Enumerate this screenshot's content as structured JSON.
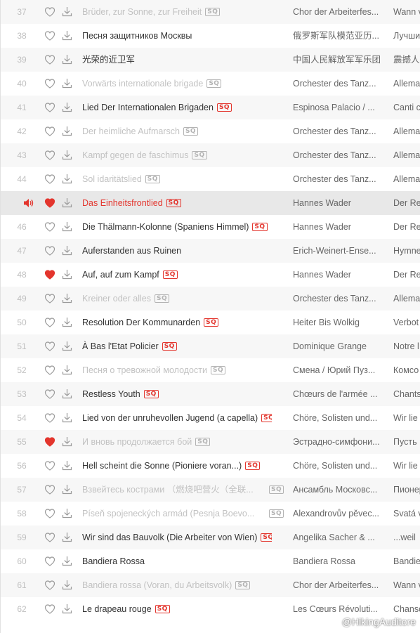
{
  "colors": {
    "accent": "#e3352d",
    "dim_text": "#c2c2c2",
    "liked_heart": "#e3352d"
  },
  "tracks": [
    {
      "no": "37",
      "title": "Brüder, zur Sonne, zur Freiheit",
      "artist": "Chor der Arbeiterfes...",
      "album": "Wann v",
      "sq": true,
      "dim": true,
      "liked": false,
      "playing": false
    },
    {
      "no": "38",
      "title": "Песня защитников Москвы",
      "artist": "俄罗斯军队模范亚历...",
      "album": "Лучши",
      "sq": false,
      "dim": false,
      "liked": false,
      "playing": false
    },
    {
      "no": "39",
      "title": "光荣的近卫军",
      "artist": "中国人民解放军军乐团",
      "album": "震撼人",
      "sq": false,
      "dim": false,
      "liked": false,
      "playing": false
    },
    {
      "no": "40",
      "title": "Vorwärts internationale brigade",
      "artist": "Orchester des Tanz...",
      "album": "Allema",
      "sq": true,
      "dim": true,
      "liked": false,
      "playing": false
    },
    {
      "no": "41",
      "title": "Lied Der Internationalen Brigaden",
      "artist": "Espinosa Palacio / ...",
      "album": "Canti c",
      "sq": true,
      "dim": false,
      "liked": false,
      "playing": false
    },
    {
      "no": "42",
      "title": "Der heimliche Aufmarsch",
      "artist": "Orchester des Tanz...",
      "album": "Allema",
      "sq": true,
      "dim": true,
      "liked": false,
      "playing": false
    },
    {
      "no": "43",
      "title": "Kampf gegen de faschimus",
      "artist": "Orchester des Tanz...",
      "album": "Allema",
      "sq": true,
      "dim": true,
      "liked": false,
      "playing": false
    },
    {
      "no": "44",
      "title": "Sol idaritätslied",
      "artist": "Orchester des Tanz...",
      "album": "Allema",
      "sq": true,
      "dim": true,
      "liked": false,
      "playing": false
    },
    {
      "no": "",
      "title": "Das Einheitsfrontlied",
      "artist": "Hannes Wader",
      "album": "Der Re",
      "sq": true,
      "dim": false,
      "liked": true,
      "playing": true
    },
    {
      "no": "46",
      "title": "Die Thälmann-Kolonne (Spaniens Himmel)",
      "artist": "Hannes Wader",
      "album": "Der Re",
      "sq": true,
      "dim": false,
      "liked": false,
      "playing": false
    },
    {
      "no": "47",
      "title": "Auferstanden aus Ruinen",
      "artist": "Erich-Weinert-Ense...",
      "album": "Hymne",
      "sq": false,
      "dim": false,
      "liked": false,
      "playing": false
    },
    {
      "no": "48",
      "title": "Auf, auf zum Kampf",
      "artist": "Hannes Wader",
      "album": "Der Re",
      "sq": true,
      "dim": false,
      "liked": true,
      "playing": false
    },
    {
      "no": "49",
      "title": "Kreiner oder alles",
      "artist": "Orchester des Tanz...",
      "album": "Allema",
      "sq": true,
      "dim": true,
      "liked": false,
      "playing": false
    },
    {
      "no": "50",
      "title": "Resolution Der Kommunarden",
      "artist": "Heiter Bis Wolkig",
      "album": "Verbot",
      "sq": true,
      "dim": false,
      "liked": false,
      "playing": false
    },
    {
      "no": "51",
      "title": "À Bas l'Etat Policier",
      "artist": "Dominique Grange",
      "album": "Notre l",
      "sq": true,
      "dim": false,
      "liked": false,
      "playing": false
    },
    {
      "no": "52",
      "title": "Песня о тревожной молодости",
      "artist": "Смена / Юрий Пуз...",
      "album": "Комсо",
      "sq": true,
      "dim": true,
      "liked": false,
      "playing": false
    },
    {
      "no": "53",
      "title": "Restless Youth",
      "artist": "Chœurs de l'armée ...",
      "album": "Chants",
      "sq": true,
      "dim": false,
      "liked": false,
      "playing": false
    },
    {
      "no": "54",
      "title": "Lied von der unruhevollen Jugend (a capella)",
      "artist": "Chöre, Solisten und...",
      "album": "Wir lie",
      "sq": true,
      "dim": false,
      "liked": false,
      "playing": false
    },
    {
      "no": "55",
      "title": "И вновь продолжается бой",
      "artist": "Эстрадно-симфони...",
      "album": "Пусть",
      "sq": true,
      "dim": true,
      "liked": true,
      "playing": false
    },
    {
      "no": "56",
      "title": "Hell scheint die Sonne (Pioniere voran...)",
      "artist": "Chöre, Solisten und...",
      "album": "Wir lie",
      "sq": true,
      "dim": false,
      "liked": false,
      "playing": false
    },
    {
      "no": "57",
      "title": "Взвейтесь кострами （燃烧吧营火（全联...",
      "artist": "Ансамбль Московс...",
      "album": "Пионер",
      "sq": true,
      "sq_right": true,
      "dim": true,
      "liked": false,
      "playing": false
    },
    {
      "no": "58",
      "title": "Píseň spojeneckých armád (Pesnja Boevo...",
      "artist": "Alexandrovův pěvec...",
      "album": "Svatá v",
      "sq": true,
      "sq_right": true,
      "dim": true,
      "liked": false,
      "playing": false
    },
    {
      "no": "59",
      "title": "Wir sind das Bauvolk (Die Arbeiter von Wien)",
      "artist": "Angelika Sacher & ...",
      "album": "...weil",
      "sq": true,
      "dim": false,
      "liked": false,
      "playing": false
    },
    {
      "no": "60",
      "title": "Bandiera Rossa",
      "artist": "Bandiera Rossa",
      "album": "Bandie",
      "sq": false,
      "dim": false,
      "liked": false,
      "playing": false
    },
    {
      "no": "61",
      "title": "Bandiera rossa (Voran, du Arbeitsvolk)",
      "artist": "Chor der Arbeiterfes...",
      "album": "Wann v",
      "sq": true,
      "dim": true,
      "liked": false,
      "playing": false
    },
    {
      "no": "62",
      "title": "Le drapeau rouge",
      "artist": "Les Cœurs Révoluti...",
      "album": "Chanso",
      "sq": true,
      "dim": false,
      "liked": false,
      "playing": false
    }
  ],
  "sq_label": "SQ",
  "watermark": "@HikingAuditore"
}
